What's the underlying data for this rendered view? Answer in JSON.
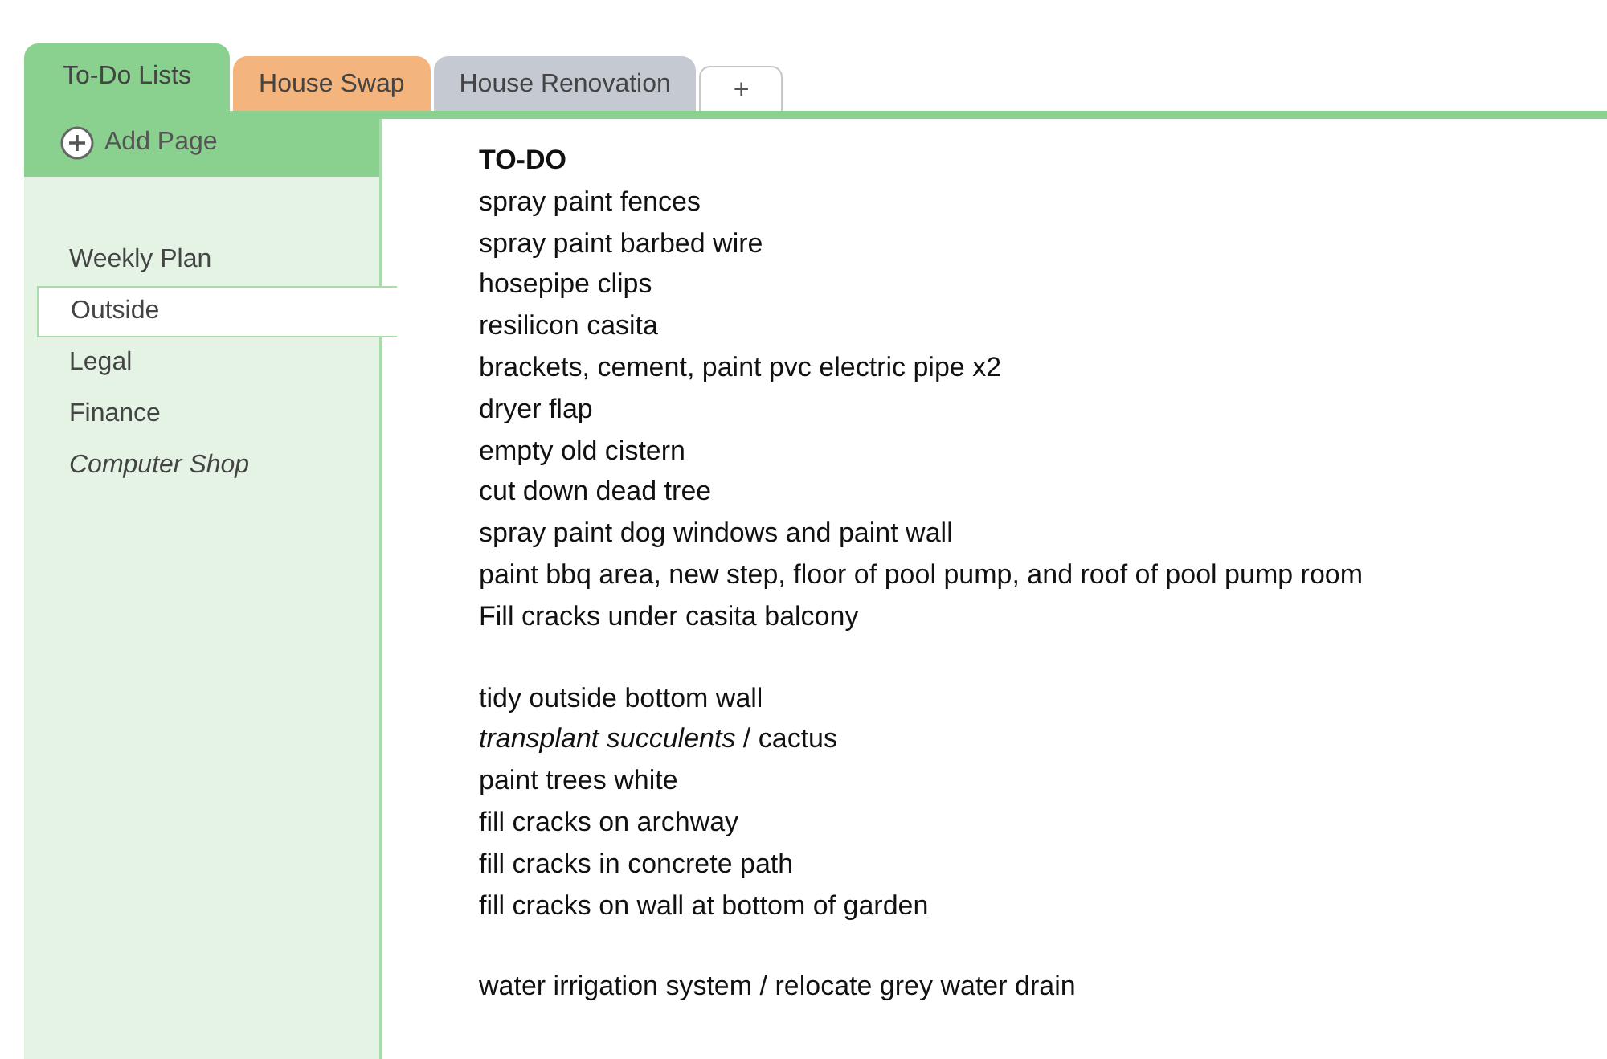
{
  "tabs": [
    {
      "label": "To-Do Lists",
      "selected": true,
      "color": "#8ad08f"
    },
    {
      "label": "House Swap",
      "selected": false,
      "color": "#f3b47e"
    },
    {
      "label": "House Renovation",
      "selected": false,
      "color": "#c5c9d1"
    }
  ],
  "add_section": {
    "label": "+"
  },
  "add_page": {
    "label": "Add Page"
  },
  "pages": [
    {
      "label": "Weekly Plan",
      "selected": false,
      "italic": false
    },
    {
      "label": "Outside",
      "selected": true,
      "italic": false
    },
    {
      "label": "Legal",
      "selected": false,
      "italic": false
    },
    {
      "label": "Finance",
      "selected": false,
      "italic": false
    },
    {
      "label": "Computer Shop",
      "selected": false,
      "italic": true
    }
  ],
  "note": {
    "title": "TO-DO",
    "groups": [
      [
        "spray paint fences",
        "spray paint barbed wire",
        "hosepipe clips",
        "resilicon casita",
        "brackets, cement, paint pvc electric pipe x2",
        "dryer flap",
        "empty old cistern",
        "cut down dead tree",
        "spray paint dog windows and paint wall",
        "paint bbq area, new step, floor of pool pump, and roof of pool pump room",
        "Fill cracks under casita balcony"
      ],
      [
        "tidy outside bottom wall",
        "*transplant succulents* / cactus",
        "paint trees white",
        "fill cracks on archway",
        "fill cracks in concrete path",
        "fill cracks on wall at bottom of garden"
      ],
      [
        "water irrigation system / relocate grey water drain"
      ]
    ]
  }
}
